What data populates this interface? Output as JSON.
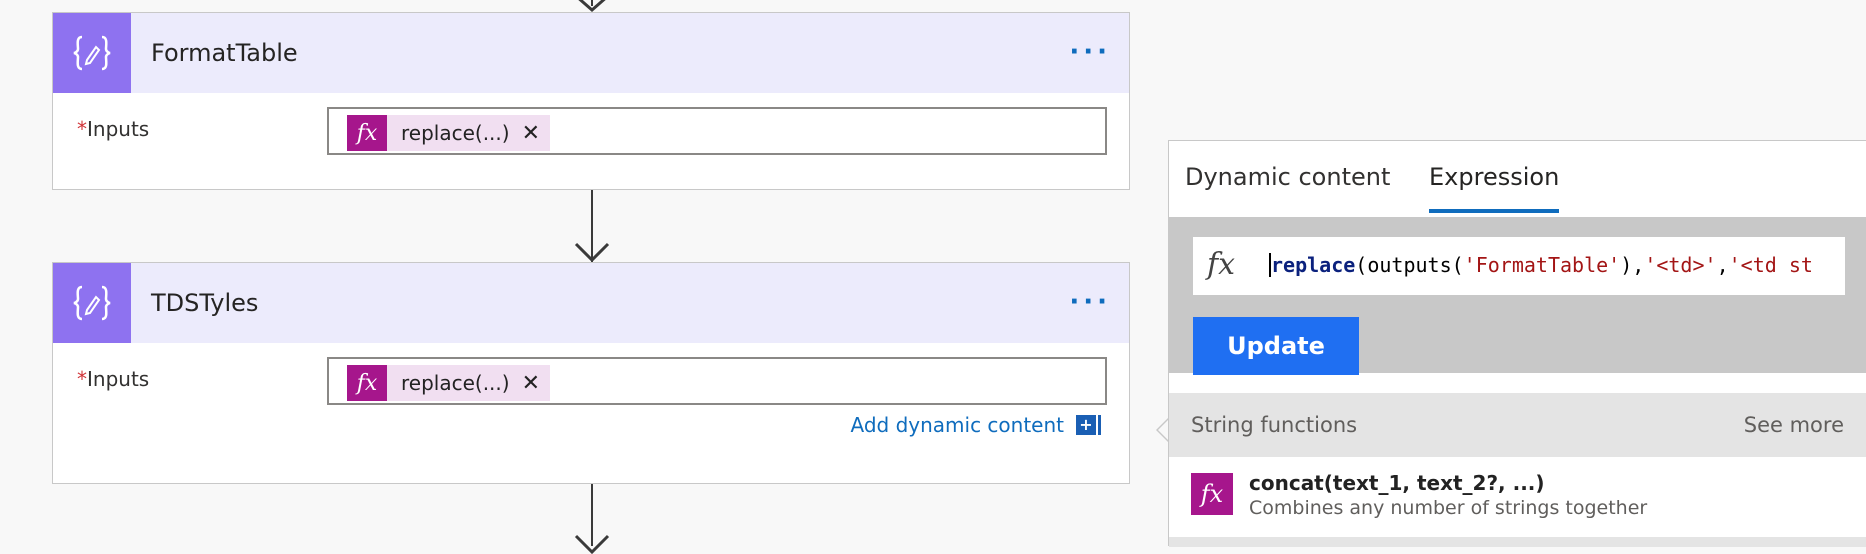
{
  "cards": [
    {
      "title": "FormatTable",
      "more_label": "···",
      "inputs_required": "*",
      "inputs_label": "Inputs",
      "token": {
        "fx": "fx",
        "text": "replace(...)",
        "remove": "✕"
      }
    },
    {
      "title": "TDSTyles",
      "more_label": "···",
      "inputs_required": "*",
      "inputs_label": "Inputs",
      "token": {
        "fx": "fx",
        "text": "replace(...)",
        "remove": "✕"
      },
      "add_dynamic_content": "Add dynamic content",
      "add_dynamic_icon": "+"
    }
  ],
  "panel": {
    "tabs": [
      {
        "label": "Dynamic content",
        "active": false
      },
      {
        "label": "Expression",
        "active": true
      }
    ],
    "expression": {
      "fx": "fx",
      "part1": "replace",
      "part2": "(outputs(",
      "part3": "'FormatTable'",
      "part4": "),",
      "part5": "'<td>'",
      "part6": ",",
      "part7": "'<td st"
    },
    "update_label": "Update",
    "section_label": "String functions",
    "see_more_label": "See more",
    "functions": [
      {
        "fx": "fx",
        "name": "concat(text_1, text_2?, ...)",
        "description": "Combines any number of strings together"
      }
    ]
  },
  "colors": {
    "card_icon_bg": "#8e72f0",
    "card_header_bg": "#ecebfc",
    "fx_token_bg": "#a6168c",
    "accent": "#0f6cbd",
    "update_button": "#1f6ff2"
  },
  "icons": {
    "card_icon": "curly-braces-pencil-icon",
    "more_icon": "ellipsis-icon",
    "token_remove": "close-icon",
    "connector": "arrow-down-icon"
  }
}
